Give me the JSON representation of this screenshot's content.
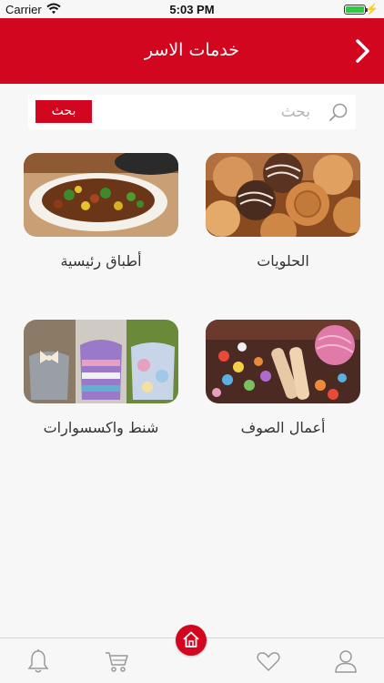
{
  "status_bar": {
    "carrier": "Carrier",
    "time": "5:03 PM"
  },
  "header": {
    "title": "خدمات الاسر"
  },
  "search": {
    "placeholder": "بحث",
    "button_label": "بحث"
  },
  "categories": [
    {
      "label": "الحلويات",
      "image": "sweets"
    },
    {
      "label": "أطباق رئيسية",
      "image": "main-dishes"
    },
    {
      "label": "أعمال الصوف",
      "image": "wool-crafts"
    },
    {
      "label": "شنط واكسسوارات",
      "image": "bags-accessories"
    }
  ],
  "tab_bar": {
    "icons": [
      "bell-icon",
      "cart-icon",
      "home-icon",
      "heart-icon",
      "user-icon"
    ]
  },
  "colors": {
    "brand": "#d3061f",
    "background": "#f7f7f7"
  }
}
